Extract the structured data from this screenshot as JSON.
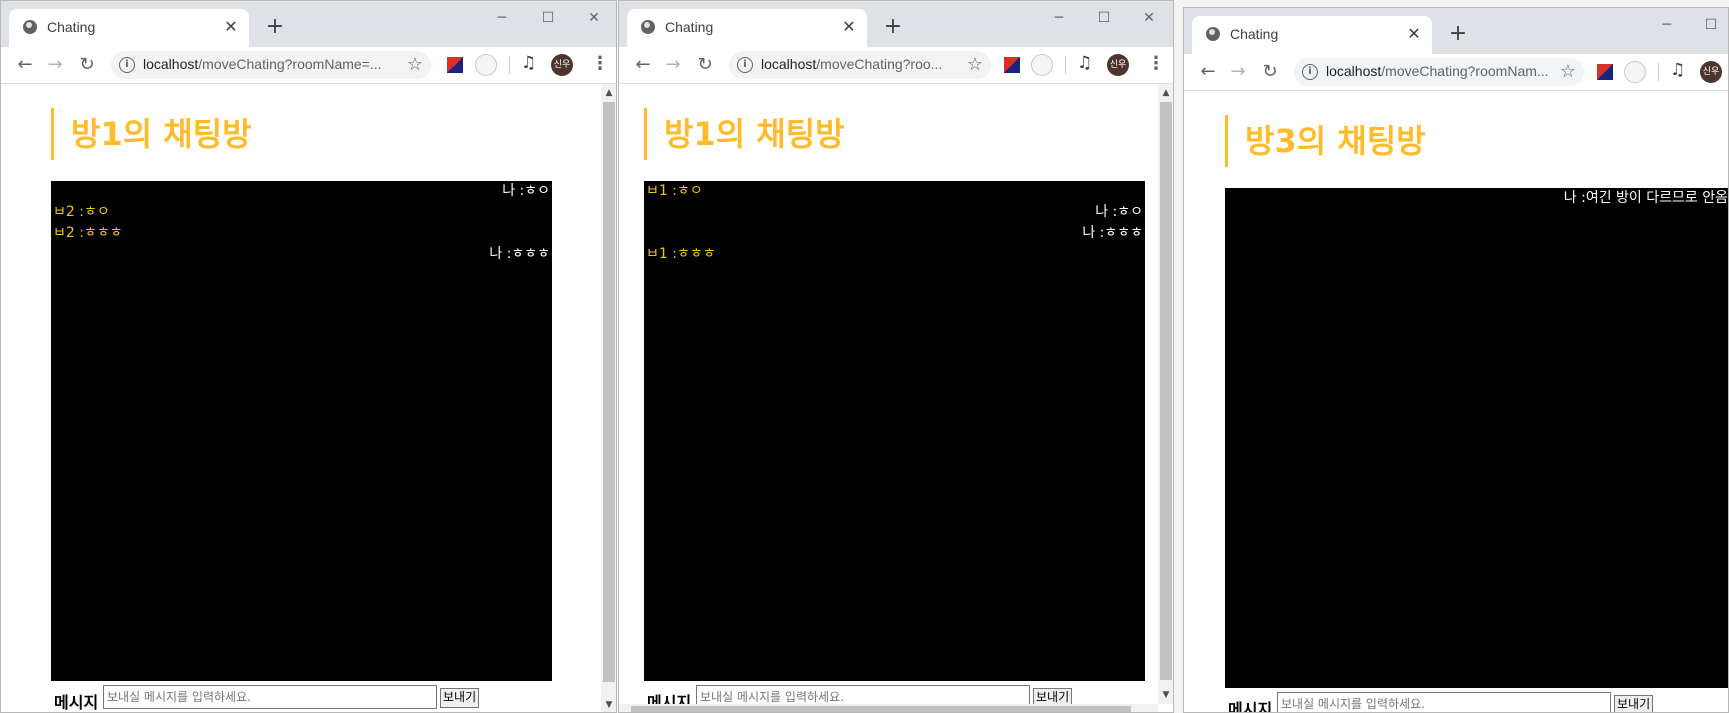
{
  "windows": [
    {
      "tab_title": "Chating",
      "url_host": "localhost",
      "url_path": "/moveChating?roomName=...",
      "avatar": "신우",
      "heading": "방1의 채팅방",
      "messages": [
        {
          "text": "나 :ㅎㅇ",
          "mine": true
        },
        {
          "text": "ㅂ2 :ㅎㅇ",
          "mine": false
        },
        {
          "text": "ㅂ2 :ㅎㅎㅎ",
          "mine": false
        },
        {
          "text": "나 :ㅎㅎㅎ",
          "mine": true
        }
      ],
      "message_label": "메시지",
      "input_placeholder": "보내실 메시지를 입력하세요.",
      "send_label": "보내기"
    },
    {
      "tab_title": "Chating",
      "url_host": "localhost",
      "url_path": "/moveChating?roo...",
      "avatar": "신우",
      "heading": "방1의 채팅방",
      "messages": [
        {
          "text": "ㅂ1 :ㅎㅇ",
          "mine": false
        },
        {
          "text": "나 :ㅎㅇ",
          "mine": true
        },
        {
          "text": "나 :ㅎㅎㅎ",
          "mine": true
        },
        {
          "text": "ㅂ1 :ㅎㅎㅎ",
          "mine": false
        }
      ],
      "message_label": "메시지",
      "input_placeholder": "보내실 메시지를 입력하세요.",
      "send_label": "보내기"
    },
    {
      "tab_title": "Chating",
      "url_host": "localhost",
      "url_path": "/moveChating?roomNam...",
      "avatar": "신우",
      "heading": "방3의 채팅방",
      "messages": [
        {
          "text": "나 :여긴 방이 다르므로 안옴",
          "mine": true
        }
      ],
      "message_label": "메시지",
      "input_placeholder": "보내실 메시지를 입력하세요.",
      "send_label": "보내기"
    }
  ],
  "icons": {
    "back": "arrow-left-icon",
    "forward": "arrow-right-icon",
    "reload": "reload-icon",
    "info": "info-icon",
    "bookmark": "star-icon",
    "menu": "kebab-menu-icon",
    "media": "media-control-icon",
    "favicon": "globe-icon"
  },
  "colors": {
    "heading_accent": "#ffbb2a",
    "other_message": "#f1c40f",
    "my_message": "#ffffff",
    "chat_background": "#000000"
  }
}
